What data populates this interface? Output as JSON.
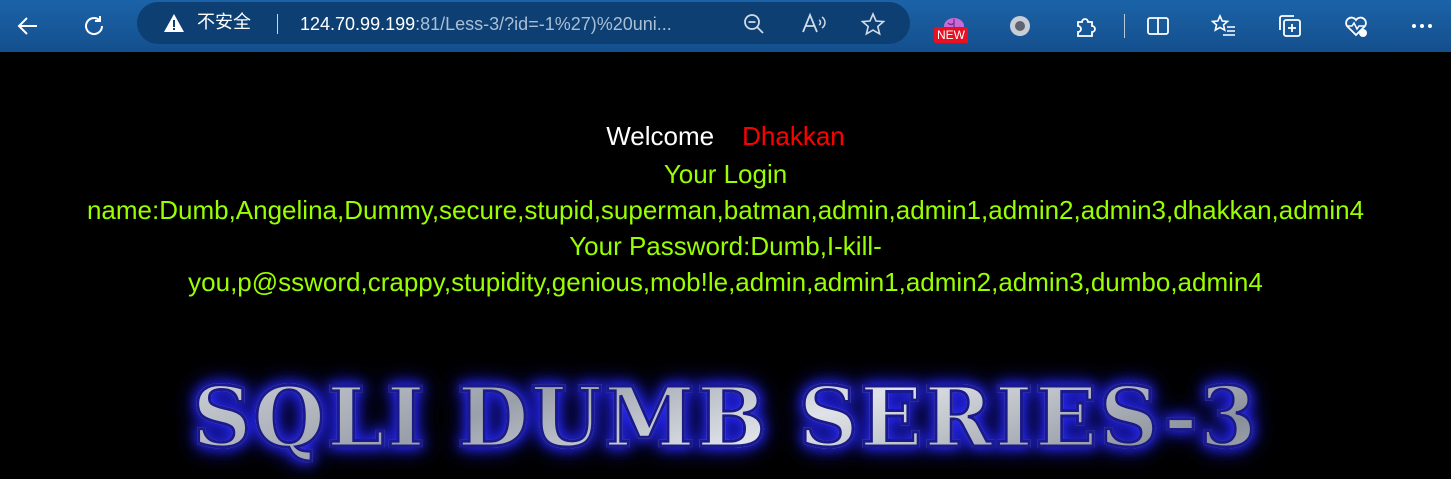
{
  "browser": {
    "security_label": "不安全",
    "url_host": "124.70.99.199",
    "url_rest": ":81/Less-3/?id=-1%27)%20uni...",
    "new_badge": "NEW",
    "icons": {
      "back": "back-arrow-icon",
      "refresh": "refresh-icon",
      "warning": "warning-icon",
      "zoom": "zoom-out-icon",
      "read_aloud": "read-aloud-icon",
      "favorite": "star-icon",
      "extension_new": "brain-extension-icon",
      "record": "record-icon",
      "extensions": "puzzle-icon",
      "split_screen": "split-screen-icon",
      "favorites": "favorites-list-icon",
      "collections": "collections-icon",
      "health": "browser-essentials-icon",
      "more": "more-icon"
    },
    "colors": {
      "toolbar": "#175a9d",
      "address_bar": "#0e3f72",
      "badge": "#e81123"
    }
  },
  "page": {
    "welcome": "Welcome",
    "user": "Dhakkan",
    "login_line1": "Your Login",
    "login_line2": "name:Dumb,Angelina,Dummy,secure,stupid,superman,batman,admin,admin1,admin2,admin3,dhakkan,admin4",
    "password_line1": "Your Password:Dumb,I-kill-",
    "password_line2": "you,p@ssword,crappy,stupidity,genious,mob!le,admin,admin1,admin2,admin3,dumbo,admin4",
    "series_title": "SQLI DUMB SERIES-3",
    "colors": {
      "background": "#000000",
      "welcome": "#ffffff",
      "user": "#ff0000",
      "result": "#99ff00"
    }
  }
}
